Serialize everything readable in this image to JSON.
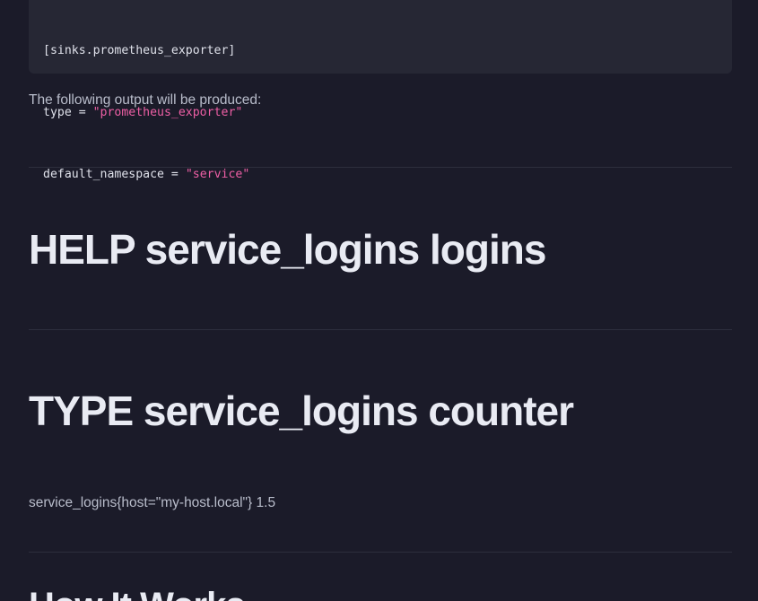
{
  "code": {
    "line1": "[sinks.prometheus_exporter]",
    "line2_key": "type",
    "line2_op": " = ",
    "line2_val": "\"prometheus_exporter\"",
    "line3_key": "default_namespace",
    "line3_op": " = ",
    "line3_val": "\"service\""
  },
  "intro_text": "The following output will be produced:",
  "heading_help": "HELP service_logins logins",
  "heading_type": "TYPE service_logins counter",
  "metric_line": "service_logins{host=\"my-host.local\"} 1.5",
  "heading_next": "How It Works"
}
